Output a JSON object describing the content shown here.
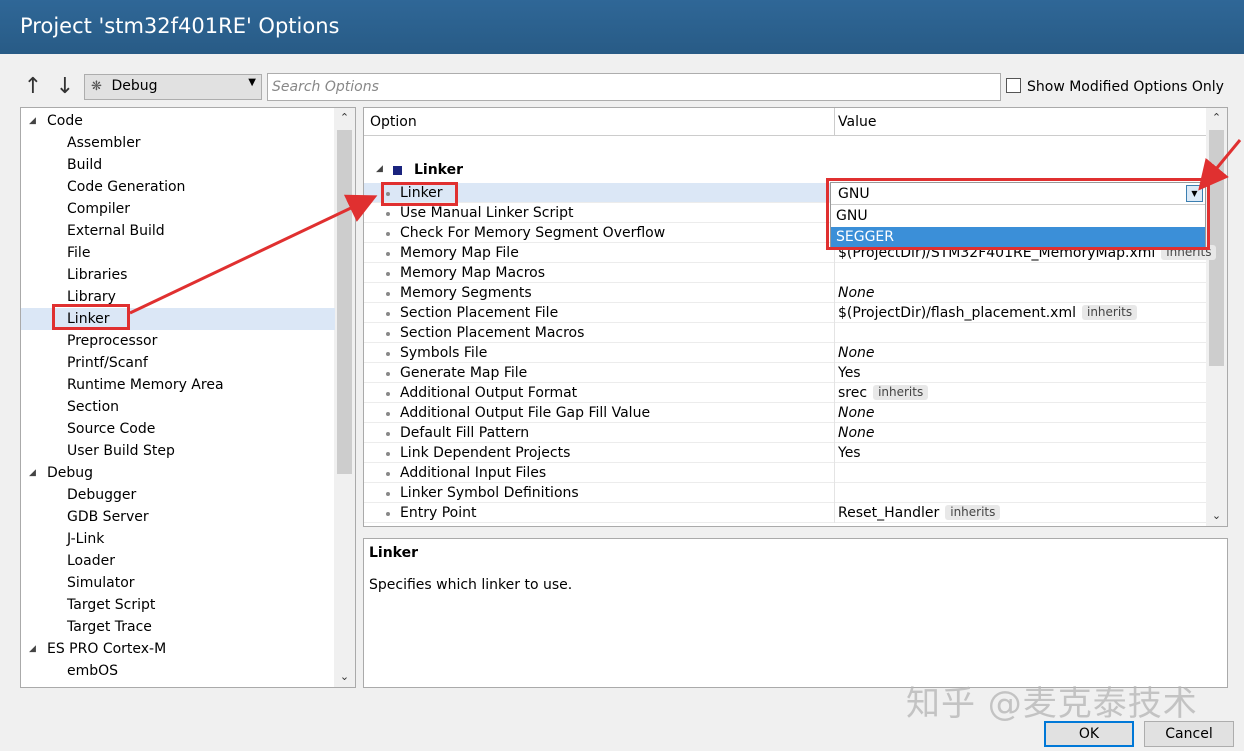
{
  "window": {
    "title": "Project 'stm32f401RE' Options"
  },
  "toolbar": {
    "up_icon": "arrow-up-icon",
    "down_icon": "arrow-down-icon",
    "configuration": "Debug",
    "search_placeholder": "Search Options",
    "show_modified_label": "Show Modified Options Only",
    "show_modified_checked": false
  },
  "tree": {
    "groups": [
      {
        "label": "Code",
        "items": [
          "Assembler",
          "Build",
          "Code Generation",
          "Compiler",
          "External Build",
          "File",
          "Libraries",
          "Library",
          "Linker",
          "Preprocessor",
          "Printf/Scanf",
          "Runtime Memory Area",
          "Section",
          "Source Code",
          "User Build Step"
        ]
      },
      {
        "label": "Debug",
        "items": [
          "Debugger",
          "GDB Server",
          "J-Link",
          "Loader",
          "Simulator",
          "Target Script",
          "Target Trace"
        ]
      },
      {
        "label": "ES PRO Cortex-M",
        "items": [
          "embOS"
        ]
      }
    ],
    "selected": "Linker"
  },
  "grid": {
    "header_option": "Option",
    "header_value": "Value",
    "category": "Linker",
    "rows": [
      {
        "name": "Linker",
        "value": "GNU"
      },
      {
        "name": "Use Manual Linker Script",
        "value": ""
      },
      {
        "name": "Check For Memory Segment Overflow",
        "value": ""
      },
      {
        "name": "Memory Map File",
        "value": "$(ProjectDir)/STM32F401RE_MemoryMap.xml",
        "badge": "inherits"
      },
      {
        "name": "Memory Map Macros",
        "value": ""
      },
      {
        "name": "Memory Segments",
        "value": "None",
        "italic": true
      },
      {
        "name": "Section Placement File",
        "value": "$(ProjectDir)/flash_placement.xml",
        "badge": "inherits"
      },
      {
        "name": "Section Placement Macros",
        "value": ""
      },
      {
        "name": "Symbols File",
        "value": "None",
        "italic": true
      },
      {
        "name": "Generate Map File",
        "value": "Yes"
      },
      {
        "name": "Additional Output Format",
        "value": "srec",
        "badge": "inherits"
      },
      {
        "name": "Additional Output File Gap Fill Value",
        "value": "None",
        "italic": true
      },
      {
        "name": "Default Fill Pattern",
        "value": "None",
        "italic": true
      },
      {
        "name": "Link Dependent Projects",
        "value": "Yes"
      },
      {
        "name": "Additional Input Files",
        "value": ""
      },
      {
        "name": "Linker Symbol Definitions",
        "value": ""
      },
      {
        "name": "Entry Point",
        "value": "Reset_Handler",
        "badge": "inherits"
      }
    ]
  },
  "dropdown": {
    "current": "GNU",
    "options": [
      "GNU",
      "SEGGER"
    ],
    "highlighted": "SEGGER"
  },
  "description": {
    "title": "Linker",
    "text": "Specifies which linker to use."
  },
  "buttons": {
    "ok": "OK",
    "cancel": "Cancel"
  },
  "watermark": "知乎 @麦克泰技术",
  "annotation_color": "#e03030"
}
